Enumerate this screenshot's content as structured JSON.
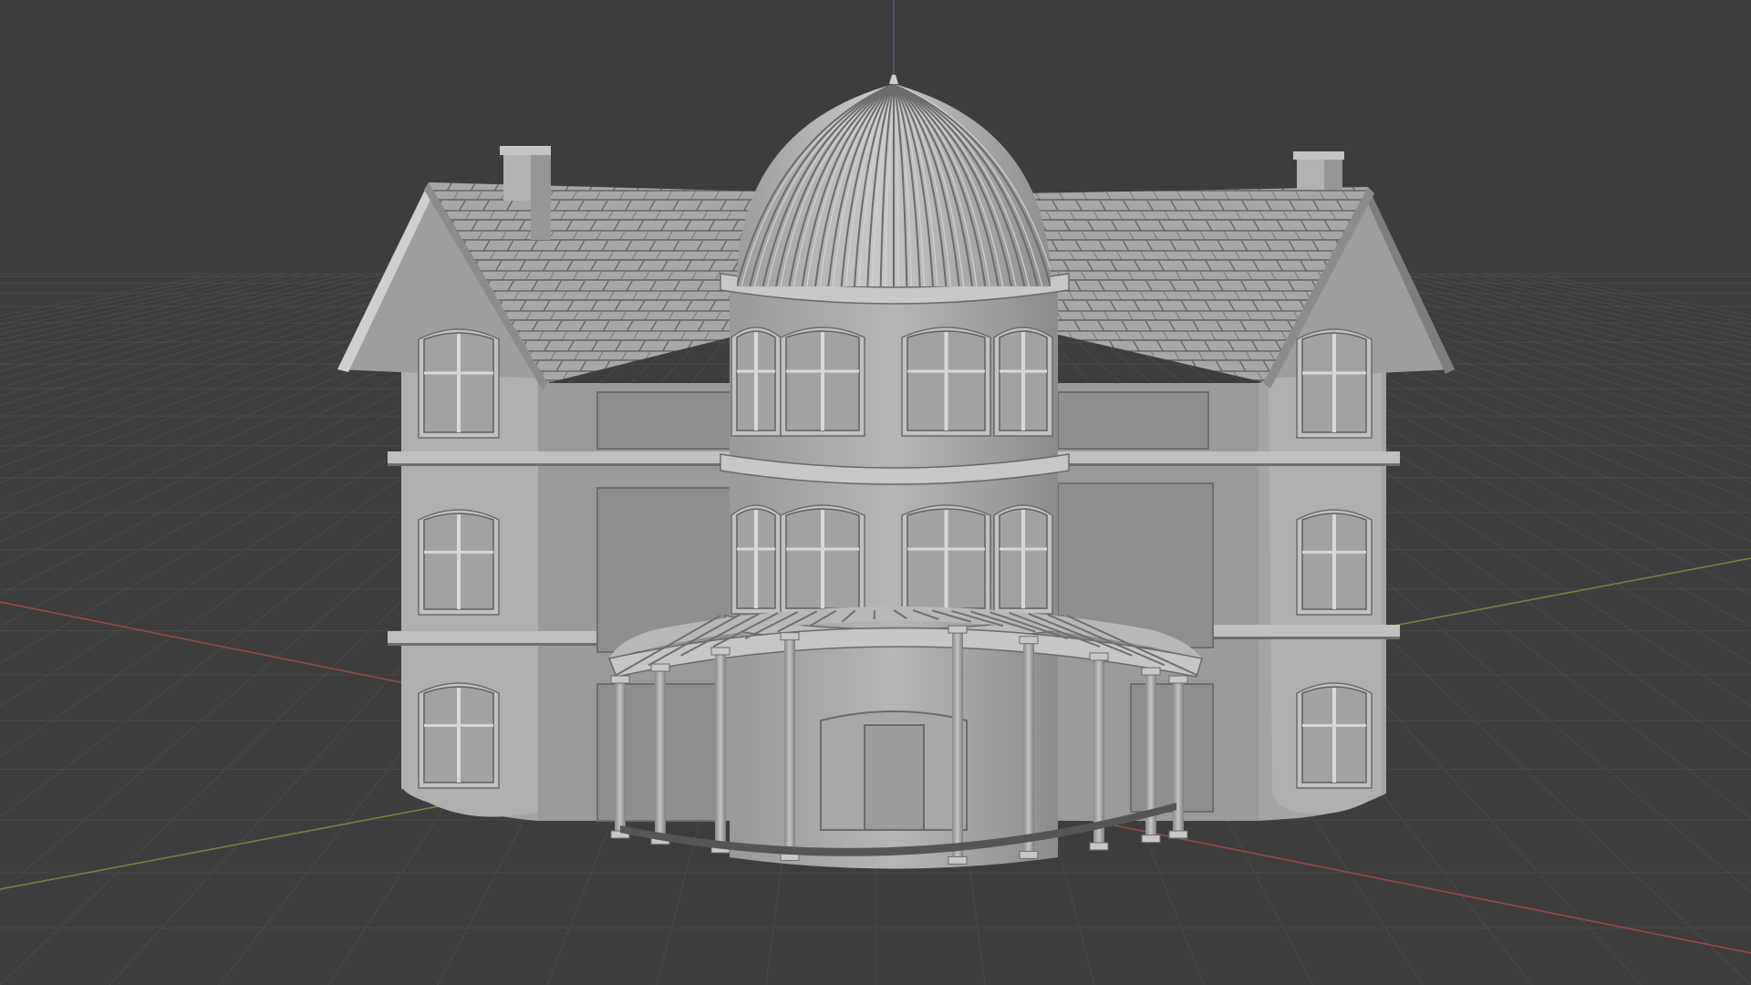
{
  "viewport": {
    "background_color": "#3d3d3d",
    "grid_color": "#4a4a4a",
    "x_axis_color": "#9a4a4a",
    "y_axis_color": "#6e8a3e",
    "z_axis_color": "#5a6a8a"
  },
  "scene": {
    "object": "house-model",
    "shading": "solid",
    "model_color": "#a9a9a9"
  }
}
